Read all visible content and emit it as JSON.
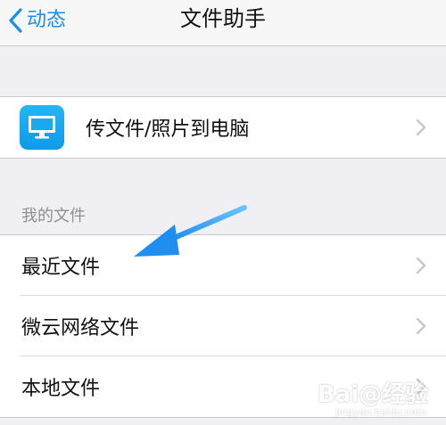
{
  "navbar": {
    "back_label": "动态",
    "title": "文件助手"
  },
  "transfer_row": {
    "label": "传文件/照片到电脑",
    "icon": "monitor-icon"
  },
  "section_header": "我的文件",
  "files": [
    {
      "label": "最近文件"
    },
    {
      "label": "微云网络文件"
    },
    {
      "label": "本地文件"
    }
  ],
  "colors": {
    "accent": "#1a8df2",
    "background": "#efeff4",
    "icon_bg": "#1aa8ee",
    "arrow": "#2b9bf0"
  },
  "watermark": {
    "main": "Bai@经验",
    "sub": "jingyan.baidu.com"
  }
}
